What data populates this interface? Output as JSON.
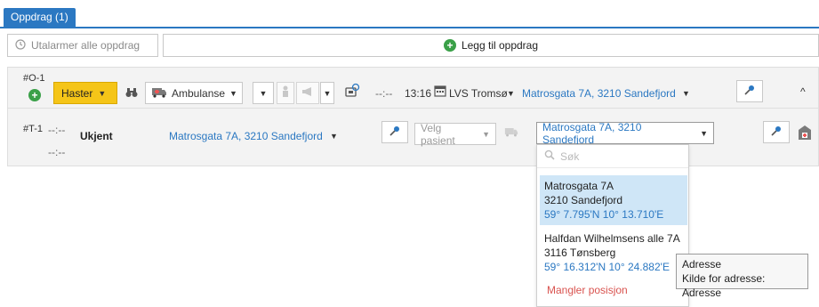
{
  "tabs": [
    {
      "label": "Oppdrag (1)"
    }
  ],
  "toolbar": {
    "alarm_label": "Utalarmer alle oppdrag",
    "add_label": "Legg til oppdrag"
  },
  "mission": {
    "id": "#O-1",
    "priority": "Haster",
    "vehicle_type": "Ambulanse",
    "time_from": "--:--",
    "time_to": "13:16",
    "destination": "LVS Tromsø",
    "address": "Matrosgata 7A, 3210 Sandefjord",
    "colors": {
      "priority_bg": "#f5c518",
      "link": "#2b78c2",
      "accent": "#2b78c2"
    }
  },
  "task": {
    "id": "#T-1",
    "time1": "--:--",
    "time2": "--:--",
    "status": "Ukjent",
    "from_address": "Matrosgata 7A, 3210 Sandefjord",
    "patient_placeholder": "Velg pasient",
    "to_address": "Matrosgata 7A, 3210 Sandefjord"
  },
  "dropdown": {
    "search_placeholder": "Søk",
    "options": [
      {
        "line1": "Matrosgata 7A",
        "line2": "3210 Sandefjord",
        "coords": "59° 7.795'N 10° 13.710'E",
        "selected": true
      },
      {
        "line1": "Halfdan Wilhelmsens alle 7A",
        "line2": "3116 Tønsberg",
        "coords": "59° 16.312'N 10° 24.882'E",
        "selected": false
      }
    ],
    "missing_label": "Mangler posisjon"
  },
  "tooltip": {
    "title": "Adresse",
    "body": "Kilde for adresse: Adresse"
  },
  "icons": [
    "history-icon",
    "plus-circle-icon",
    "binoculars-icon",
    "ambulance-icon",
    "person-icon",
    "megaphone-icon",
    "phone-icon",
    "calendar-icon",
    "pin-icon",
    "search-icon",
    "building-icon",
    "chevron-up-icon"
  ]
}
